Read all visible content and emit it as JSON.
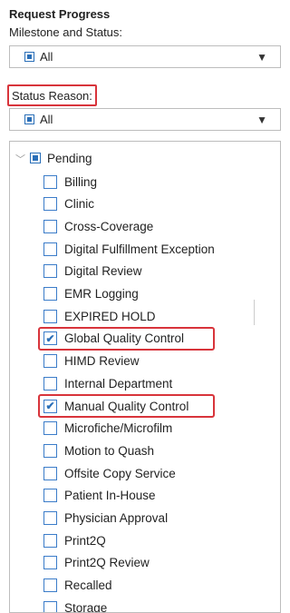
{
  "header": {
    "title": "Request Progress",
    "milestone_label": "Milestone and Status:"
  },
  "milestone_select": {
    "value": "All"
  },
  "status_reason": {
    "label": "Status Reason:",
    "select_value": "All"
  },
  "tree": {
    "group_label": "Pending",
    "items": [
      {
        "label": "Billing",
        "checked": false
      },
      {
        "label": "Clinic",
        "checked": false
      },
      {
        "label": "Cross-Coverage",
        "checked": false
      },
      {
        "label": "Digital Fulfillment Exception",
        "checked": false
      },
      {
        "label": "Digital Review",
        "checked": false
      },
      {
        "label": "EMR Logging",
        "checked": false
      },
      {
        "label": "EXPIRED HOLD",
        "checked": false
      },
      {
        "label": "Global Quality Control",
        "checked": true,
        "highlight": true
      },
      {
        "label": "HIMD Review",
        "checked": false
      },
      {
        "label": "Internal Department",
        "checked": false
      },
      {
        "label": "Manual Quality Control",
        "checked": true,
        "highlight": true
      },
      {
        "label": "Microfiche/Microfilm",
        "checked": false
      },
      {
        "label": "Motion to Quash",
        "checked": false
      },
      {
        "label": "Offsite Copy Service",
        "checked": false
      },
      {
        "label": "Patient In-House",
        "checked": false
      },
      {
        "label": "Physician Approval",
        "checked": false
      },
      {
        "label": "Print2Q",
        "checked": false
      },
      {
        "label": "Print2Q Review",
        "checked": false
      },
      {
        "label": "Recalled",
        "checked": false
      },
      {
        "label": "Storage",
        "checked": false
      }
    ]
  },
  "colors": {
    "accent": "#2a6fb8",
    "highlight": "#d8343b"
  }
}
